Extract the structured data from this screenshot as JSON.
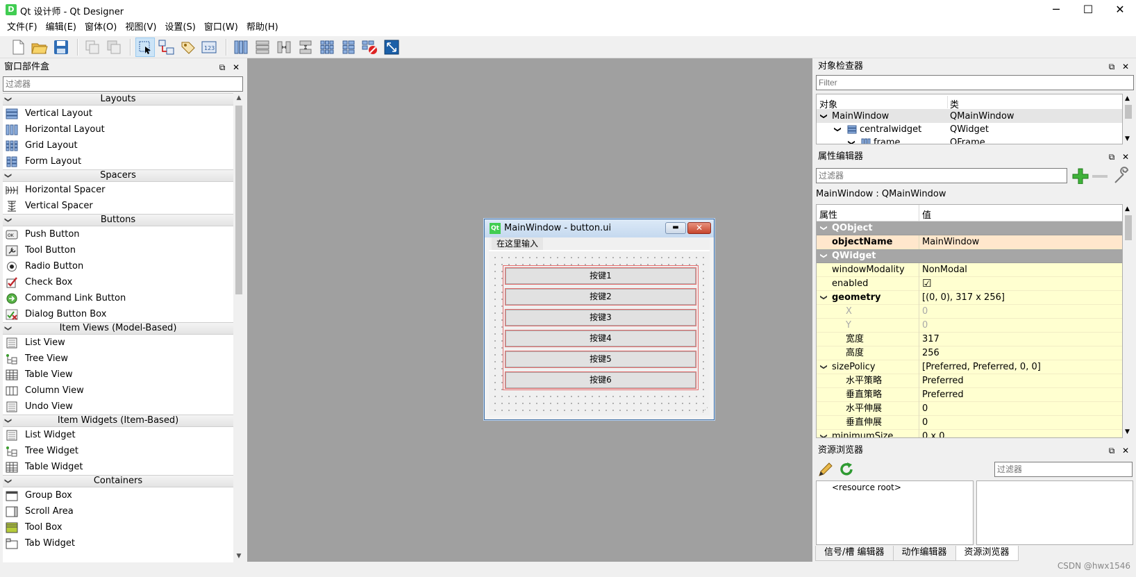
{
  "window": {
    "title": "Qt 设计师 - Qt Designer",
    "icon_letter": "D",
    "min": "─",
    "max": "☐",
    "close": "✕"
  },
  "menubar": [
    "文件(F)",
    "编辑(E)",
    "窗体(O)",
    "视图(V)",
    "设置(S)",
    "窗口(W)",
    "帮助(H)"
  ],
  "widgetbox": {
    "title": "窗口部件盒",
    "filter_placeholder": "过滤器",
    "categories": {
      "layouts": "Layouts",
      "spacers": "Spacers",
      "buttons": "Buttons",
      "item_views": "Item Views (Model-Based)",
      "item_widgets": "Item Widgets (Item-Based)",
      "containers": "Containers"
    },
    "items": {
      "vertical_layout": "Vertical Layout",
      "horizontal_layout": "Horizontal Layout",
      "grid_layout": "Grid Layout",
      "form_layout": "Form Layout",
      "horizontal_spacer": "Horizontal Spacer",
      "vertical_spacer": "Vertical Spacer",
      "push_button": "Push Button",
      "tool_button": "Tool Button",
      "radio_button": "Radio Button",
      "check_box": "Check Box",
      "command_link_button": "Command Link Button",
      "dialog_button_box": "Dialog Button Box",
      "list_view": "List View",
      "tree_view": "Tree View",
      "table_view": "Table View",
      "column_view": "Column View",
      "undo_view": "Undo View",
      "list_widget": "List Widget",
      "tree_widget": "Tree Widget",
      "table_widget": "Table Widget",
      "group_box": "Group Box",
      "scroll_area": "Scroll Area",
      "tool_box": "Tool Box",
      "tab_widget": "Tab Widget"
    }
  },
  "form": {
    "title": "MainWindow - button.ui",
    "menu_placeholder": "在这里输入",
    "buttons": [
      "按键1",
      "按键2",
      "按键3",
      "按键4",
      "按键5",
      "按键6"
    ]
  },
  "object_inspector": {
    "title": "对象检查器",
    "filter_placeholder": "Filter",
    "col_object": "对象",
    "col_class": "类",
    "rows": [
      {
        "name": "MainWindow",
        "cls": "QMainWindow"
      },
      {
        "name": "centralwidget",
        "cls": "QWidget"
      },
      {
        "name": "frame",
        "cls": "QFrame"
      }
    ]
  },
  "property_editor": {
    "title": "属性编辑器",
    "filter_placeholder": "过滤器",
    "context": "MainWindow : QMainWindow",
    "col_prop": "属性",
    "col_value": "值",
    "rows": {
      "qobject": "QObject",
      "objectname_n": "objectName",
      "objectname_v": "MainWindow",
      "qwidget": "QWidget",
      "windowmodality_n": "windowModality",
      "windowmodality_v": "NonModal",
      "enabled_n": "enabled",
      "enabled_v": "☑",
      "geometry_n": "geometry",
      "geometry_v": "[(0, 0), 317 x 256]",
      "x_n": "X",
      "x_v": "0",
      "y_n": "Y",
      "y_v": "0",
      "w_n": "宽度",
      "w_v": "317",
      "h_n": "高度",
      "h_v": "256",
      "sizepolicy_n": "sizePolicy",
      "sizepolicy_v": "[Preferred, Preferred, 0, 0]",
      "hpol_n": "水平策略",
      "hpol_v": "Preferred",
      "vpol_n": "垂直策略",
      "vpol_v": "Preferred",
      "hstr_n": "水平伸展",
      "hstr_v": "0",
      "vstr_n": "垂直伸展",
      "vstr_v": "0",
      "minsize_n": "minimumSize",
      "minsize_v": "0 x 0"
    }
  },
  "resource_browser": {
    "title": "资源浏览器",
    "filter_placeholder": "过滤器",
    "root": "<resource root>",
    "tabs": [
      "信号/槽 编辑器",
      "动作编辑器",
      "资源浏览器"
    ]
  },
  "watermark": "CSDN @hwx1546",
  "colors": {
    "accent": "#41cd52",
    "group_row": "#a6a6a6",
    "prop_yellow": "#ffffd0",
    "selection_red": "#e46d6d"
  }
}
